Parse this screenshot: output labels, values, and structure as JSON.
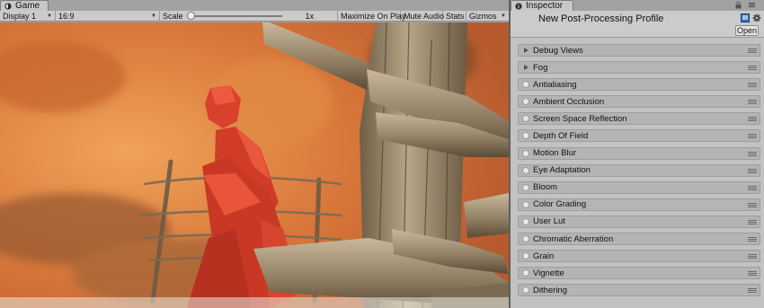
{
  "game": {
    "tab_label": "Game",
    "toolbar": {
      "display": "Display 1",
      "aspect": "16:9",
      "scale_label": "Scale",
      "scale_value": "1x",
      "maximize": "Maximize On Play",
      "mute": "Mute Audio",
      "stats": "Stats",
      "gizmos": "Gizmos"
    }
  },
  "inspector": {
    "tab_label": "Inspector",
    "profile_title": "New Post-Processing Profile",
    "open_button": "Open",
    "effects": [
      {
        "label": "Debug Views",
        "style": "foldout"
      },
      {
        "label": "Fog",
        "style": "foldout"
      },
      {
        "label": "Antialiasing",
        "style": "toggle"
      },
      {
        "label": "Ambient Occlusion",
        "style": "toggle"
      },
      {
        "label": "Screen Space Reflection",
        "style": "toggle"
      },
      {
        "label": "Depth Of Field",
        "style": "toggle"
      },
      {
        "label": "Motion Blur",
        "style": "toggle"
      },
      {
        "label": "Eye Adaptation",
        "style": "toggle"
      },
      {
        "label": "Bloom",
        "style": "toggle"
      },
      {
        "label": "Color Grading",
        "style": "toggle"
      },
      {
        "label": "User Lut",
        "style": "toggle"
      },
      {
        "label": "Chromatic Aberration",
        "style": "toggle"
      },
      {
        "label": "Grain",
        "style": "toggle"
      },
      {
        "label": "Vignette",
        "style": "toggle"
      },
      {
        "label": "Dithering",
        "style": "toggle"
      }
    ]
  },
  "icons": [
    "game-tab-icon",
    "inspector-tab-icon",
    "lock-icon",
    "panel-menu-icon",
    "profile-asset-icon",
    "settings-gear-icon",
    "effect-options-icon"
  ],
  "colors": {
    "panel_bg": "#c2c2c2",
    "row_bg": "#b4b4b4",
    "divider": "#5f5f5f"
  }
}
